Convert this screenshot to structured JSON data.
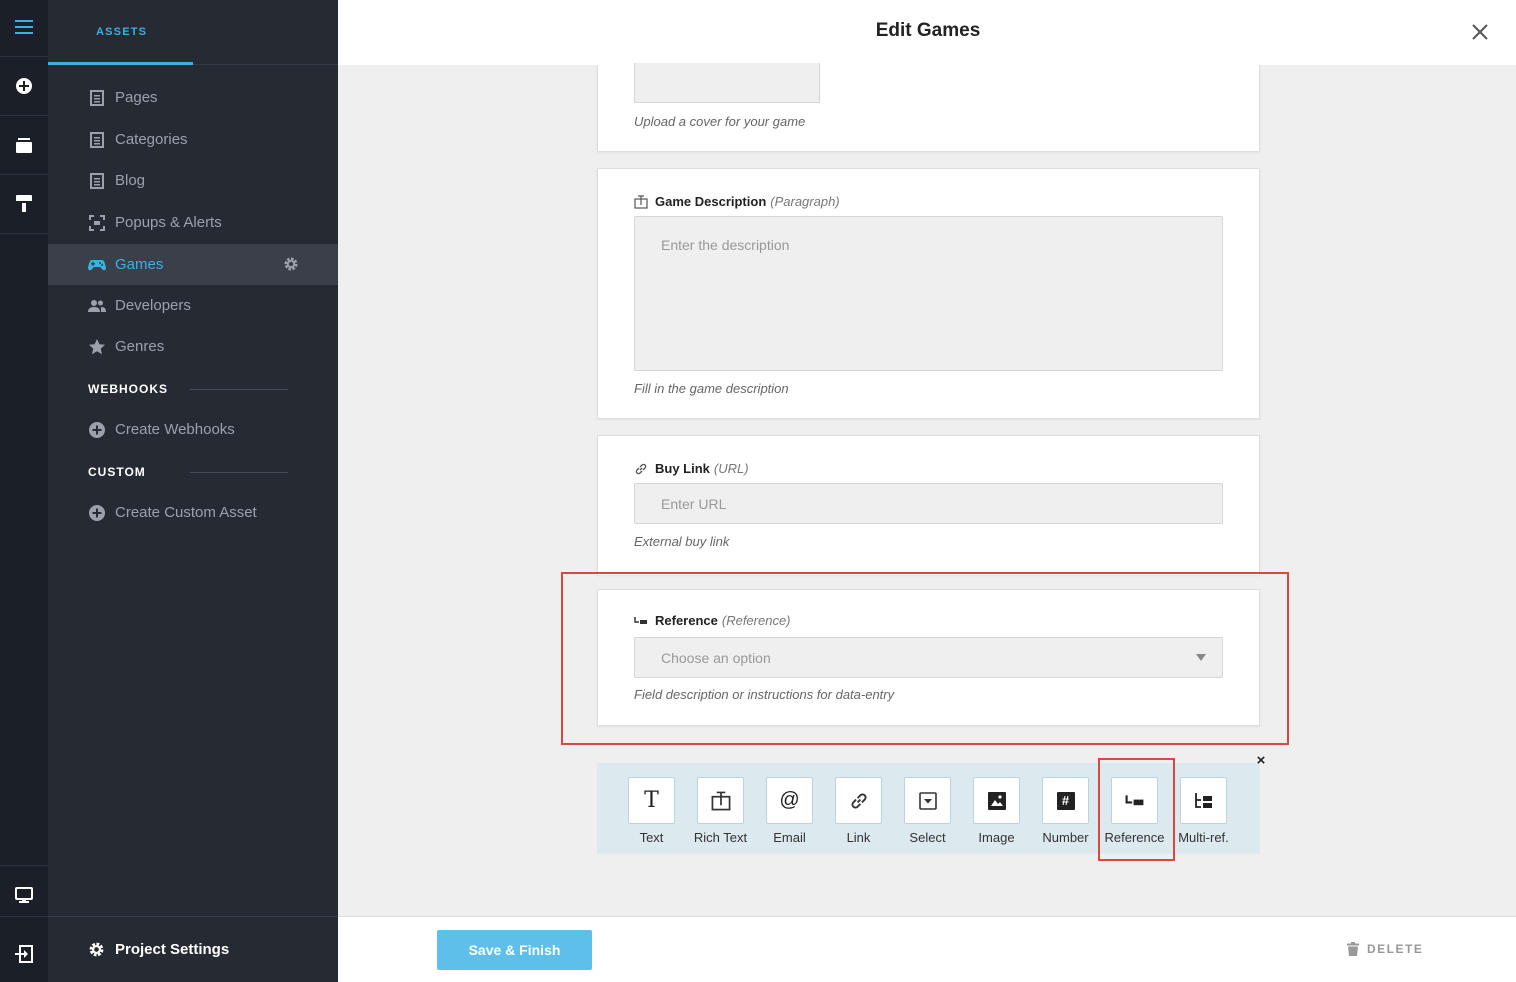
{
  "rail": {
    "icons": [
      "hamburger-menu-icon",
      "add-circle-icon",
      "stack-icon",
      "brush-icon",
      "monitor-icon",
      "exit-icon"
    ]
  },
  "sidebar": {
    "header": "ASSETS",
    "items": [
      {
        "label": "Pages",
        "icon": "page-icon"
      },
      {
        "label": "Categories",
        "icon": "page-icon"
      },
      {
        "label": "Blog",
        "icon": "page-icon"
      },
      {
        "label": "Popups & Alerts",
        "icon": "popup-icon"
      },
      {
        "label": "Games",
        "icon": "gamepad-icon",
        "active": true
      },
      {
        "label": "Developers",
        "icon": "users-icon"
      },
      {
        "label": "Genres",
        "icon": "star-icon"
      }
    ],
    "webhooks_section": "WEBHOOKS",
    "create_webhooks": "Create Webhooks",
    "custom_section": "CUSTOM",
    "create_custom_asset": "Create Custom Asset",
    "project_settings": "Project Settings"
  },
  "modal": {
    "title": "Edit Games",
    "cover_help": "Upload a cover for your game",
    "description": {
      "label": "Game Description",
      "type": "(Paragraph)",
      "placeholder": "Enter the description",
      "help": "Fill in the game description"
    },
    "buy_link": {
      "label": "Buy Link",
      "type": "(URL)",
      "placeholder": "Enter URL",
      "help": "External buy link"
    },
    "reference": {
      "label": "Reference",
      "type": "(Reference)",
      "placeholder": "Choose an option",
      "help": "Field description or instructions for data-entry"
    },
    "field_types": [
      {
        "label": "Text",
        "glyph": "T"
      },
      {
        "label": "Rich Text",
        "glyph": ""
      },
      {
        "label": "Email",
        "glyph": "@"
      },
      {
        "label": "Link",
        "glyph": ""
      },
      {
        "label": "Select",
        "glyph": ""
      },
      {
        "label": "Image",
        "glyph": ""
      },
      {
        "label": "Number",
        "glyph": "#"
      },
      {
        "label": "Reference",
        "glyph": ""
      },
      {
        "label": "Multi-ref.",
        "glyph": ""
      }
    ],
    "save_button": "Save & Finish",
    "delete_button": "DELETE"
  },
  "colors": {
    "accent": "#3bb0e4",
    "highlight": "#d9473f",
    "sidebar_bg": "#262a33",
    "rail_bg": "#1b1f27"
  }
}
